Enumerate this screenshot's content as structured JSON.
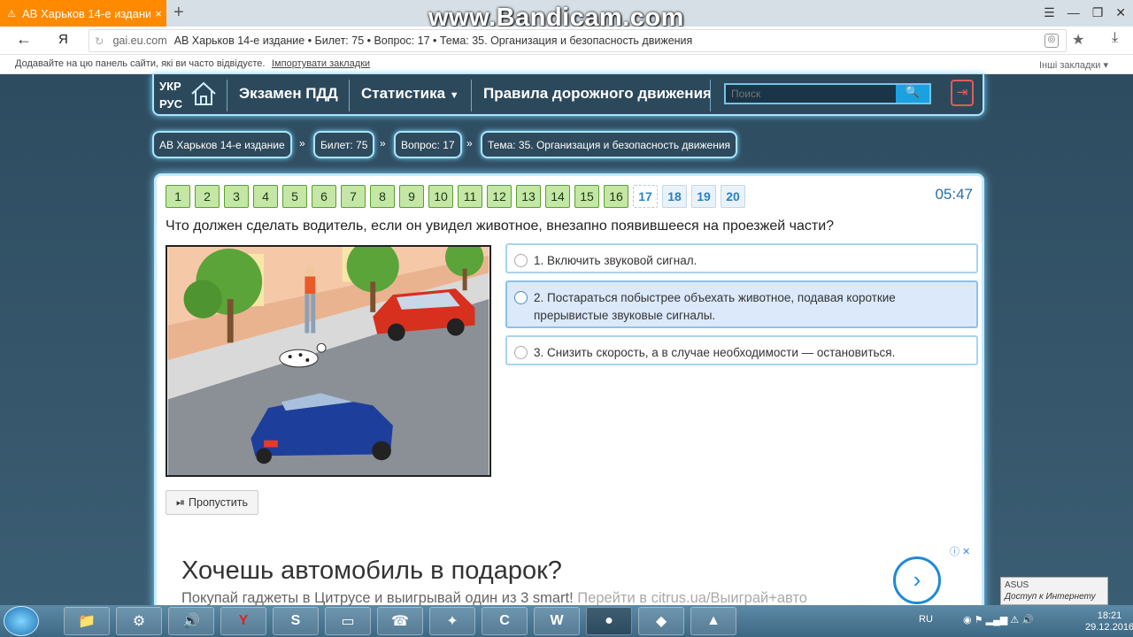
{
  "browser": {
    "tab_title": "АВ Харьков 14-е издание",
    "tab_close": "×",
    "new_tab": "+",
    "watermark": "www.Bandicam.com",
    "yandex_logo": "Я",
    "url_host": "gai.eu.com",
    "url_title": "АВ Харьков 14-е издание • Билет: 75 • Вопрос: 17 • Тема: 35. Организация и безопасность движения",
    "bookmarks_hint": "Додавайте на цю панель сайти, які ви часто відвідуєте.",
    "bookmarks_import": "Імпортувати закладки",
    "other_bookmarks": "Інші закладки"
  },
  "nav": {
    "lang_ukr": "УКР",
    "lang_rus": "РУС",
    "exam": "Экзамен ПДД",
    "stats": "Статистика",
    "rules": "Правила дорожного движения",
    "search_placeholder": "Поиск"
  },
  "breadcrumb": [
    {
      "label": "АВ Харьков 14-е издание"
    },
    {
      "label": "Билет: 75"
    },
    {
      "label": "Вопрос: 17"
    },
    {
      "label": "Тема: 35. Организация и безопасность движения"
    }
  ],
  "quiz": {
    "numbers": [
      "1",
      "2",
      "3",
      "4",
      "5",
      "6",
      "7",
      "8",
      "9",
      "10",
      "11",
      "12",
      "13",
      "14",
      "15",
      "16",
      "17",
      "18",
      "19",
      "20"
    ],
    "answered_count": 16,
    "current": "17",
    "timer": "05:47",
    "question": "Что должен сделать водитель, если он увидел животное, внезапно появившееся на проезжей части?",
    "answers": [
      {
        "text": "1. Включить звуковой сигнал."
      },
      {
        "text": "2. Постараться побыстрее объехать животное, подавая короткие прерывистые звуковые сигналы."
      },
      {
        "text": "3. Снизить скорость, а в случае необходимости — остановиться."
      }
    ],
    "skip": "Пропустить"
  },
  "ad": {
    "title": "Хочешь автомобиль в подарок?",
    "subtitle": "Покупай гаджеты в Цитрусе и выигрывай один из 3 smart!",
    "link": "Перейти в citrus.ua/Выиграй+авто"
  },
  "notification": {
    "title": "ASUS",
    "subtitle": "Доступ к Интернету"
  },
  "taskbar": {
    "lang": "RU",
    "time": "18:21",
    "date": "29.12.2016"
  }
}
